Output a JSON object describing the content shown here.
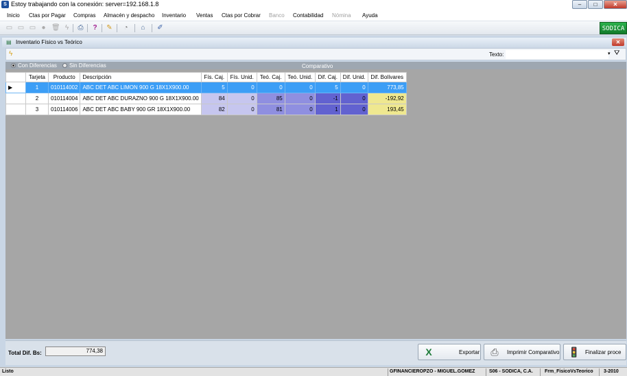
{
  "window": {
    "title": "Estoy trabajando con la conexión: server=192.168.1.8"
  },
  "menu": [
    "Inicio",
    "Ctas por Pagar",
    "Compras",
    "Almacén y despacho",
    "Inventario",
    "Ventas",
    "Ctas por Cobrar",
    "Banco",
    "Contabilidad",
    "Nómina",
    "Ayuda"
  ],
  "menu_disabled": [
    "Banco",
    "Nómina"
  ],
  "logo_text": "SODICA",
  "child": {
    "title": "Inventario Físico vs Teórico"
  },
  "filter": {
    "texto_label": "Texto:",
    "texto_value": ""
  },
  "radios": {
    "con": "Con Diferencias",
    "sin": "Sin Diferencias",
    "selected": "con"
  },
  "grid": {
    "group_header": "Comparativo",
    "columns": [
      "Tarjeta",
      "Producto",
      "Descripción",
      "Fís. Caj.",
      "Fís. Unid.",
      "Teó. Caj.",
      "Teó. Unid.",
      "Dif. Caj.",
      "Dif. Unid.",
      "Dif. Bolívares"
    ],
    "rows": [
      {
        "tarjeta": "1",
        "producto": "010114002",
        "descripcion": "ABC DET ABC LIMON 900 G 18X1X900.00",
        "fis_caj": "5",
        "fis_unid": "0",
        "teo_caj": "0",
        "teo_unid": "0",
        "dif_caj": "5",
        "dif_unid": "0",
        "dif_bs": "773,85"
      },
      {
        "tarjeta": "2",
        "producto": "010114004",
        "descripcion": "ABC DET ABC DURAZNO 900 G 18X1X900.00",
        "fis_caj": "84",
        "fis_unid": "0",
        "teo_caj": "85",
        "teo_unid": "0",
        "dif_caj": "-1",
        "dif_unid": "0",
        "dif_bs": "-192,92"
      },
      {
        "tarjeta": "3",
        "producto": "010114006",
        "descripcion": "ABC DET ABC BABY 900 GR 18X1X900.00",
        "fis_caj": "82",
        "fis_unid": "0",
        "teo_caj": "81",
        "teo_unid": "0",
        "dif_caj": "1",
        "dif_unid": "0",
        "dif_bs": "193,45"
      }
    ],
    "selected_row": 0
  },
  "footer": {
    "total_label": "Total Dif. Bs:",
    "total_value": "774,38",
    "exportar": "Exportar",
    "imprimir": "Imprimir Comparativo",
    "finalizar": "Finalizar proce"
  },
  "status": {
    "left": "Listo",
    "user": "GFINANCIEROPZO - MIGUEL.GOMEZ",
    "company": "S06 - SODICA, C.A.",
    "form": "Frm_FisicoVsTeorico",
    "period": "3-2010"
  }
}
